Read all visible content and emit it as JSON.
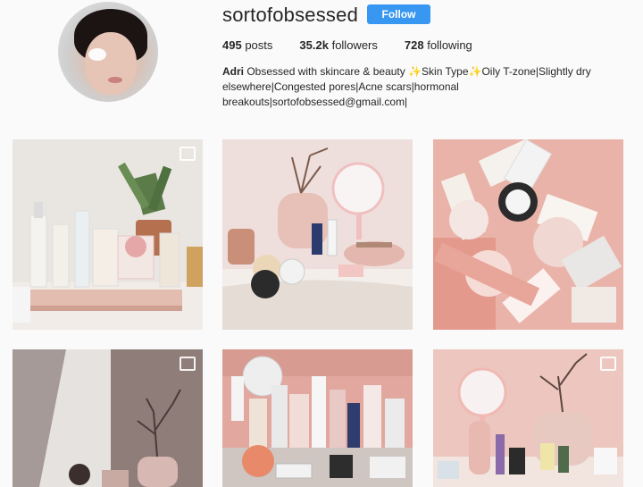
{
  "profile": {
    "username": "sortofobsessed",
    "follow_label": "Follow",
    "stats": {
      "posts_count": "495",
      "posts_label": "posts",
      "followers_count": "35.2k",
      "followers_label": "followers",
      "following_count": "728",
      "following_label": "following"
    },
    "bio": {
      "name": "Adri",
      "text": " Obsessed with skincare & beauty ✨Skin Type✨Oily T-zone|Slightly dry elsewhere|Congested pores|Acne scars|hormonal breakouts|sortofobsessed@gmail.com|"
    }
  },
  "colors": {
    "accent": "#3897f0",
    "background": "#fafafa"
  },
  "posts": [
    {
      "name": "skincare-shelf-with-aloe-plant",
      "multi": true
    },
    {
      "name": "vanity-with-candles-and-mirror",
      "multi": false
    },
    {
      "name": "pink-flatlay-matcha",
      "multi": false
    },
    {
      "name": "shadow-and-branch-vase",
      "multi": true
    },
    {
      "name": "crowded-skincare-shelf",
      "multi": false
    },
    {
      "name": "pink-vanity-mirror-and-vase",
      "multi": true
    }
  ]
}
